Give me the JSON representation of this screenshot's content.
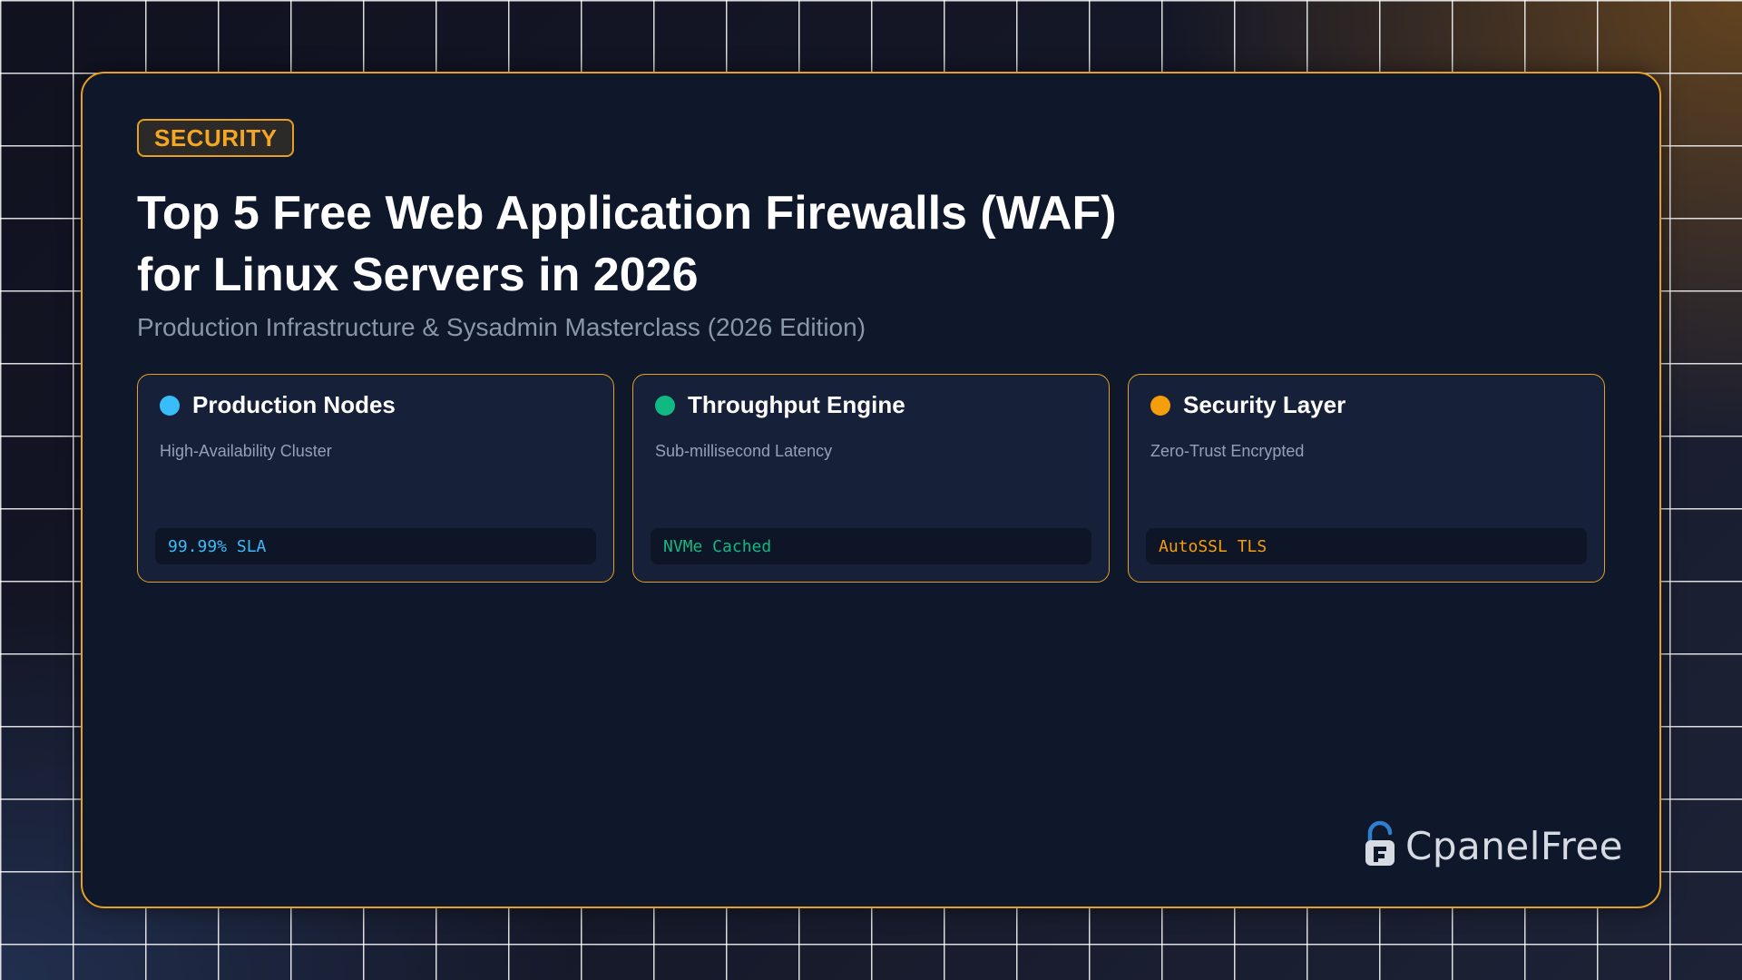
{
  "badge": "SECURITY",
  "title": "Top 5 Free Web Application Firewalls (WAF) for Linux Servers in 2026",
  "subtitle": "Production Infrastructure & Sysadmin Masterclass (2026 Edition)",
  "features": [
    {
      "title": "Production Nodes",
      "description": "High-Availability Cluster",
      "tag": "99.99% SLA",
      "color": "#38bdf8"
    },
    {
      "title": "Throughput Engine",
      "description": "Sub-millisecond Latency",
      "tag": "NVMe Cached",
      "color": "#10b981"
    },
    {
      "title": "Security Layer",
      "description": "Zero-Trust Encrypted",
      "tag": "AutoSSL TLS",
      "color": "#f59e0b"
    }
  ],
  "brand": {
    "name": "CpanelFree",
    "icon": "padlock-logo-icon",
    "accent": "#e5a020"
  }
}
